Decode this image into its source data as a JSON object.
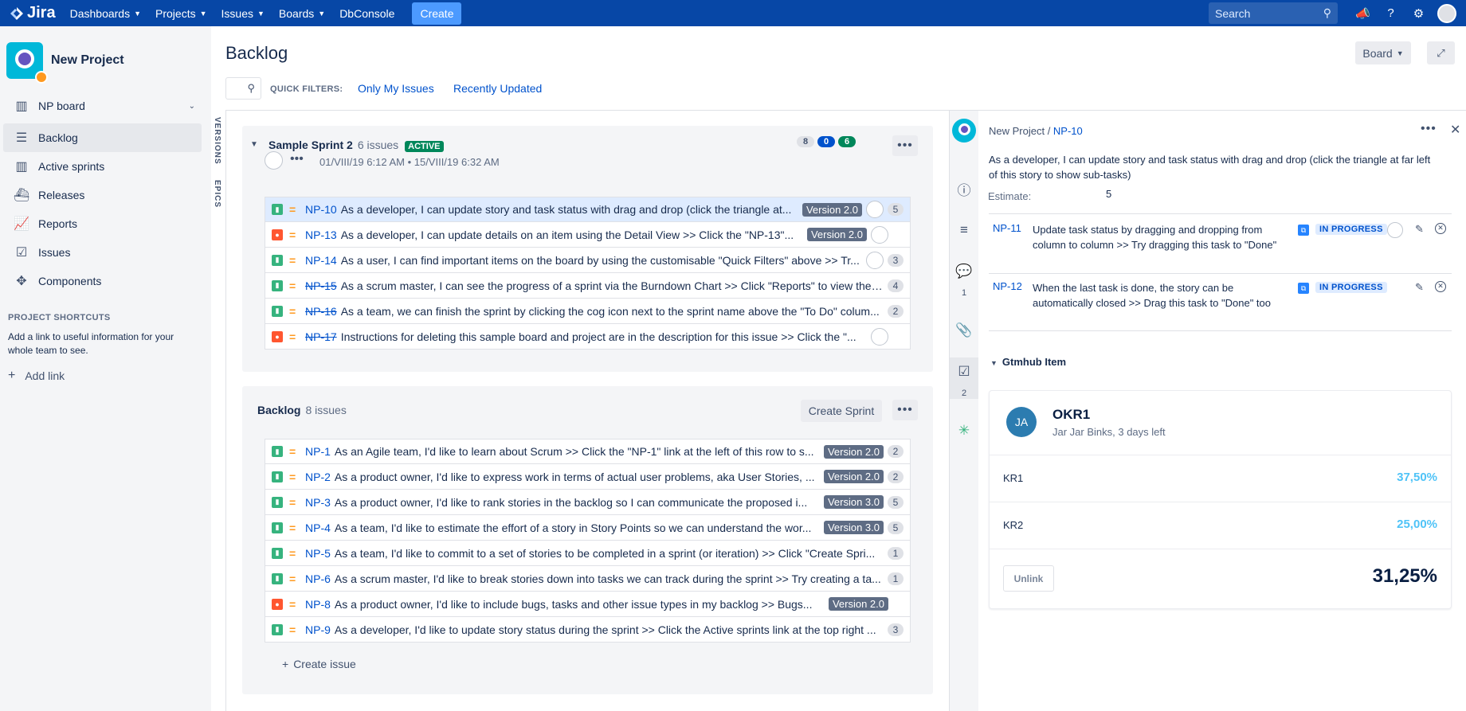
{
  "topnav": {
    "logo": "Jira",
    "items": [
      {
        "label": "Dashboards",
        "dropdown": true
      },
      {
        "label": "Projects",
        "dropdown": true
      },
      {
        "label": "Issues",
        "dropdown": true
      },
      {
        "label": "Boards",
        "dropdown": true
      },
      {
        "label": "DbConsole",
        "dropdown": false
      }
    ],
    "create": "Create",
    "search_placeholder": "Search",
    "icons": [
      "megaphone-icon",
      "help-icon",
      "settings-icon",
      "user-avatar"
    ]
  },
  "sidebar": {
    "project_name": "New Project",
    "board_selector": "NP board",
    "items": [
      {
        "label": "Backlog",
        "icon": "backlog-icon",
        "active": true
      },
      {
        "label": "Active sprints",
        "icon": "board-icon",
        "active": false
      },
      {
        "label": "Releases",
        "icon": "ship-icon",
        "active": false
      },
      {
        "label": "Reports",
        "icon": "chart-icon",
        "active": false
      },
      {
        "label": "Issues",
        "icon": "issues-icon",
        "active": false
      },
      {
        "label": "Components",
        "icon": "puzzle-icon",
        "active": false
      }
    ],
    "shortcuts_title": "PROJECT SHORTCUTS",
    "shortcuts_text": "Add a link to useful information for your whole team to see.",
    "add_link": "Add link"
  },
  "main": {
    "title": "Backlog",
    "quick_filters_label": "QUICK FILTERS:",
    "quick_filters": [
      "Only My Issues",
      "Recently Updated"
    ],
    "board_button": "Board",
    "vertical_tabs": [
      "VERSIONS",
      "EPICS"
    ]
  },
  "sprint": {
    "name": "Sample Sprint 2",
    "count": "6 issues",
    "status": "ACTIVE",
    "dates": "01/VIII/19 6:12 AM  •  15/VIII/19 6:32 AM",
    "badges": {
      "todo": "8",
      "in_progress": "0",
      "done": "6"
    },
    "issues": [
      {
        "type": "story",
        "key": "NP-10",
        "done": false,
        "summary": "As a developer, I can update story and task status with drag and drop (click the triangle at...",
        "version": "Version 2.0",
        "avatar": true,
        "estimate": "5"
      },
      {
        "type": "bug",
        "key": "NP-13",
        "done": false,
        "summary": "As a developer, I can update details on an item using the Detail View >> Click the \"NP-13\"...",
        "version": "Version 2.0",
        "avatar": true,
        "estimate": ""
      },
      {
        "type": "story",
        "key": "NP-14",
        "done": false,
        "summary": "As a user, I can find important items on the board by using the customisable \"Quick Filters\" above >> Tr...",
        "version": "",
        "avatar": true,
        "estimate": "3"
      },
      {
        "type": "story",
        "key": "NP-15",
        "done": true,
        "summary": "As a scrum master, I can see the progress of a sprint via the Burndown Chart >> Click \"Reports\" to view the ...",
        "version": "",
        "avatar": false,
        "estimate": "4"
      },
      {
        "type": "story",
        "key": "NP-16",
        "done": true,
        "summary": "As a team, we can finish the sprint by clicking the cog icon next to the sprint name above the \"To Do\" colum...",
        "version": "",
        "avatar": false,
        "estimate": "2"
      },
      {
        "type": "bug",
        "key": "NP-17",
        "done": true,
        "summary": "Instructions for deleting this sample board and project are in the description for this issue >> Click the \"...",
        "version": "",
        "avatar": true,
        "estimate": ""
      }
    ]
  },
  "backlog": {
    "name": "Backlog",
    "count": "8 issues",
    "create_sprint": "Create Sprint",
    "create_issue": "Create issue",
    "issues": [
      {
        "type": "story",
        "key": "NP-1",
        "summary": "As an Agile team, I'd like to learn about Scrum >> Click the \"NP-1\" link at the left of this row to s...",
        "version": "Version 2.0",
        "estimate": "2"
      },
      {
        "type": "story",
        "key": "NP-2",
        "summary": "As a product owner, I'd like to express work in terms of actual user problems, aka User Stories, ...",
        "version": "Version 2.0",
        "estimate": "2"
      },
      {
        "type": "story",
        "key": "NP-3",
        "summary": "As a product owner, I'd like to rank stories in the backlog so I can communicate the proposed i...",
        "version": "Version 3.0",
        "estimate": "5"
      },
      {
        "type": "story",
        "key": "NP-4",
        "summary": "As a team, I'd like to estimate the effort of a story in Story Points so we can understand the wor...",
        "version": "Version 3.0",
        "estimate": "5"
      },
      {
        "type": "story",
        "key": "NP-5",
        "summary": "As a team, I'd like to commit to a set of stories to be completed in a sprint (or iteration) >> Click \"Create Spri...",
        "version": "",
        "estimate": "1"
      },
      {
        "type": "story",
        "key": "NP-6",
        "summary": "As a scrum master, I'd like to break stories down into tasks we can track during the sprint >> Try creating a ta...",
        "version": "",
        "estimate": "1"
      },
      {
        "type": "bug",
        "key": "NP-8",
        "summary": "As a product owner, I'd like to include bugs, tasks and other issue types in my backlog >> Bugs...",
        "version": "Version 2.0",
        "estimate": ""
      },
      {
        "type": "story",
        "key": "NP-9",
        "summary": "As a developer, I'd like to update story status during the sprint >> Click the Active sprints link at the top right ...",
        "version": "",
        "estimate": "3"
      }
    ]
  },
  "detail": {
    "project": "New Project",
    "key": "NP-10",
    "summary": "As a developer, I can update story and task status with drag and drop (click the triangle at far left of this story to show sub-tasks)",
    "estimate_label": "Estimate:",
    "estimate_value": "5",
    "rail": {
      "comments_count": "1",
      "subtasks_count": "2"
    },
    "subtasks": [
      {
        "key": "NP-11",
        "summary": "Update task status by dragging and dropping from column to column >> Try dragging this task to \"Done\"",
        "status": "IN PROGRESS",
        "avatar": true
      },
      {
        "key": "NP-12",
        "summary": "When the last task is done, the story can be automatically closed >> Drag this task to \"Done\" too",
        "status": "IN PROGRESS",
        "avatar": false
      }
    ],
    "gtmhub": {
      "title": "Gtmhub Item",
      "initials": "JA",
      "okr": "OKR1",
      "owner": "Jar Jar Binks, 3 days left",
      "krs": [
        {
          "name": "KR1",
          "value": "37,50%"
        },
        {
          "name": "KR2",
          "value": "25,00%"
        }
      ],
      "unlink": "Unlink",
      "total": "31,25%"
    }
  }
}
